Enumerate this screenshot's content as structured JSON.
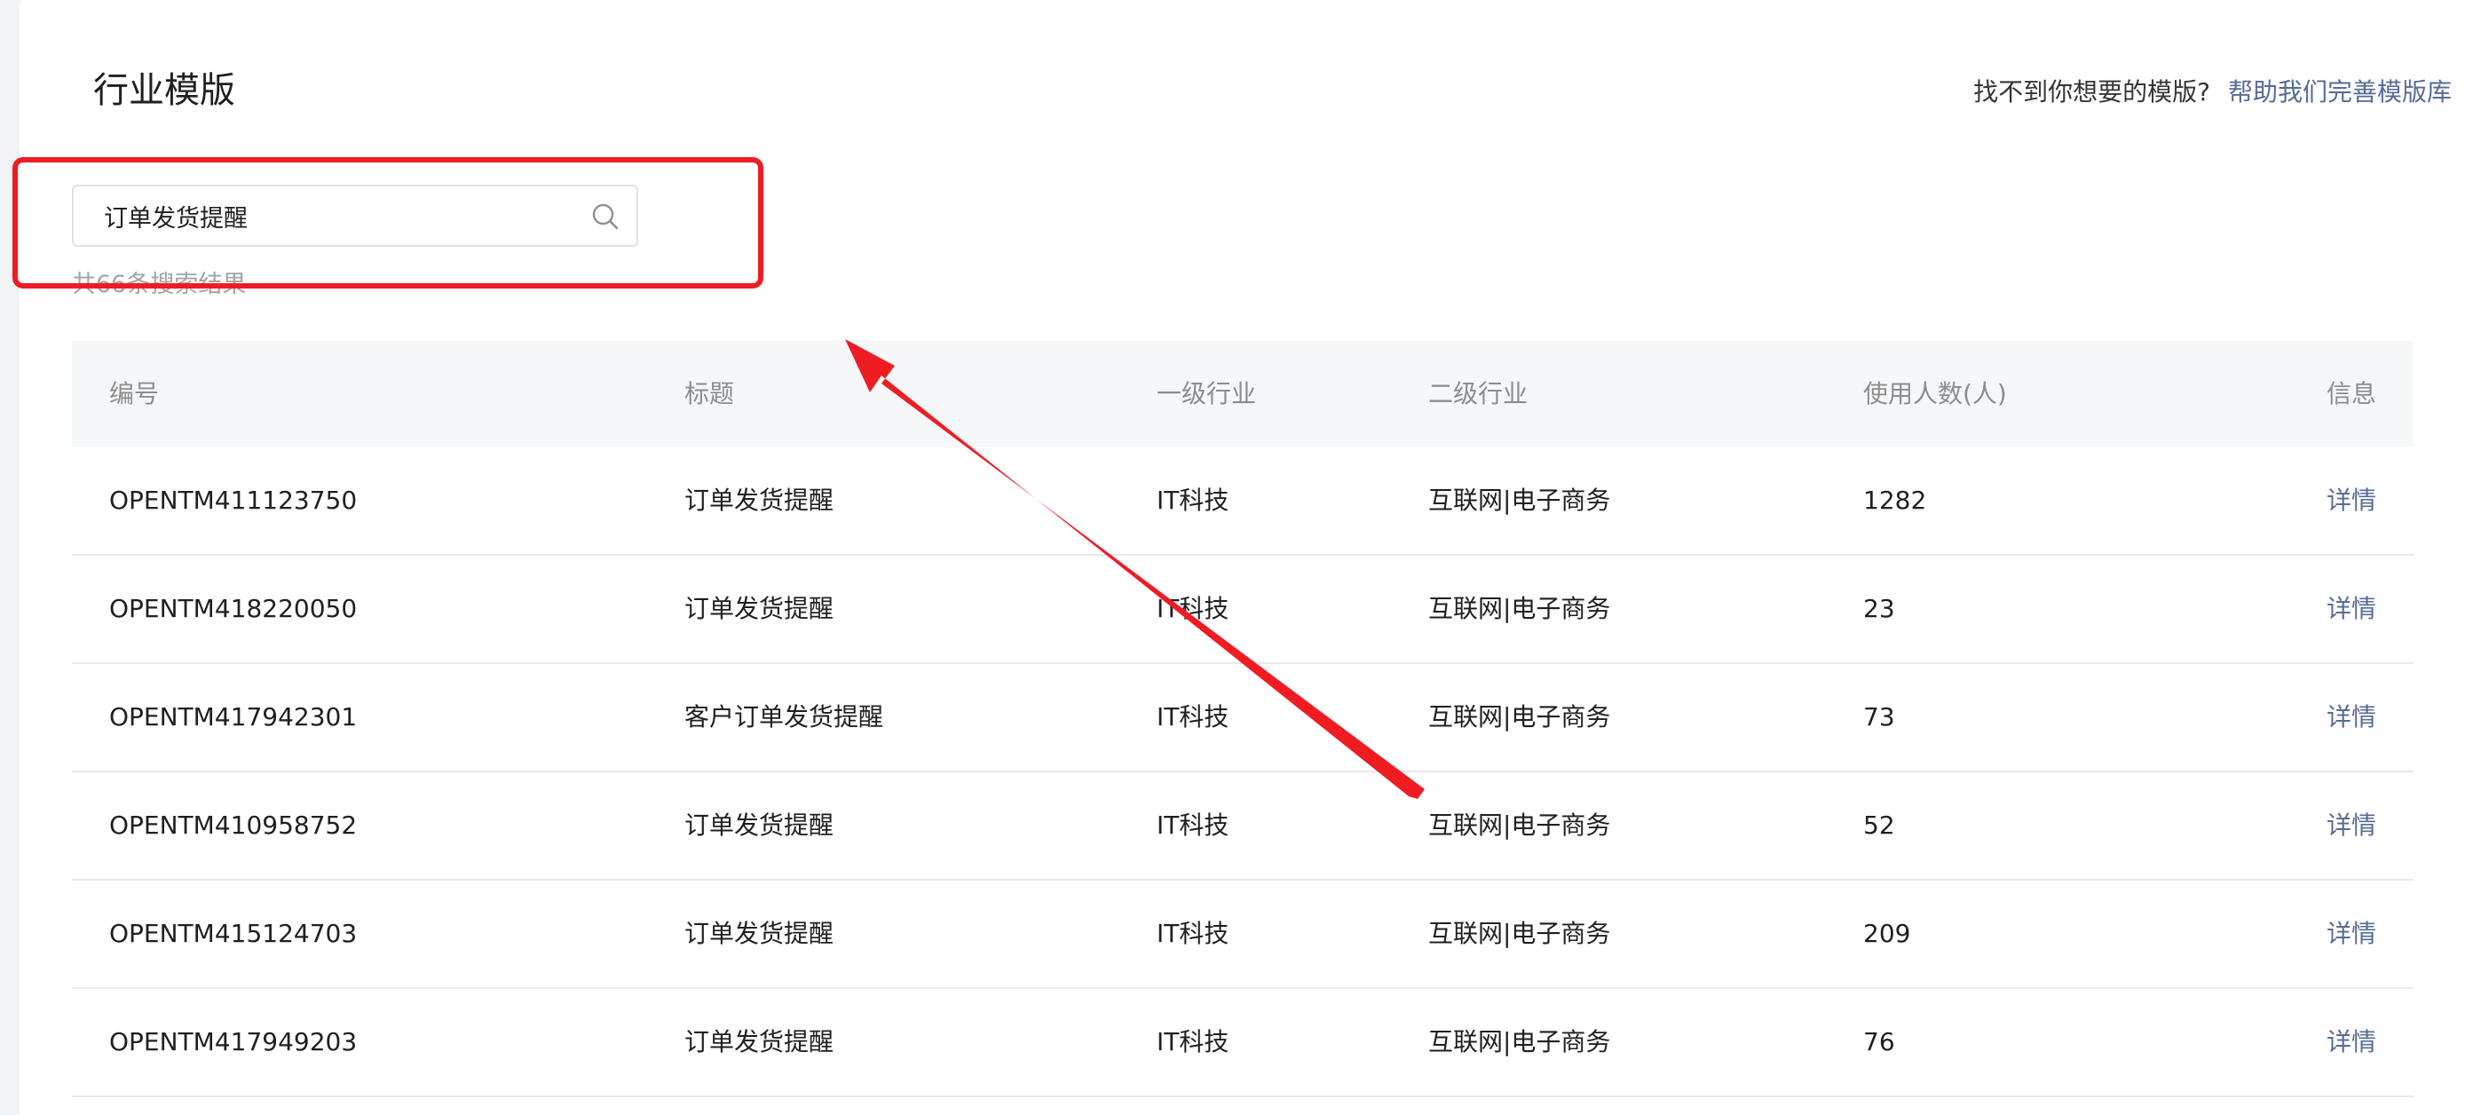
{
  "page": {
    "title": "行业模版",
    "help_question": "找不到你想要的模版?",
    "help_link": "帮助我们完善模版库"
  },
  "search": {
    "value": "订单发货提醒",
    "icon": "search-icon",
    "result_count": "共66条搜索结果"
  },
  "table": {
    "headers": [
      "编号",
      "标题",
      "一级行业",
      "二级行业",
      "使用人数(人)",
      "信息"
    ],
    "rows": [
      [
        "OPENTM411123750",
        "订单发货提醒",
        "IT科技",
        "互联网|电子商务",
        "1282",
        "详情"
      ],
      [
        "OPENTM418220050",
        "订单发货提醒",
        "IT科技",
        "互联网|电子商务",
        "23",
        "详情"
      ],
      [
        "OPENTM417942301",
        "客户订单发货提醒",
        "IT科技",
        "互联网|电子商务",
        "73",
        "详情"
      ],
      [
        "OPENTM410958752",
        "订单发货提醒",
        "IT科技",
        "互联网|电子商务",
        "52",
        "详情"
      ],
      [
        "OPENTM415124703",
        "订单发货提醒",
        "IT科技",
        "互联网|电子商务",
        "209",
        "详情"
      ],
      [
        "OPENTM417949203",
        "订单发货提醒",
        "IT科技",
        "互联网|电子商务",
        "76",
        "详情"
      ]
    ]
  },
  "colors": {
    "annotation_red": "#ef1c24",
    "link_blue": "#576b95",
    "header_bg": "#f6f7f9"
  }
}
